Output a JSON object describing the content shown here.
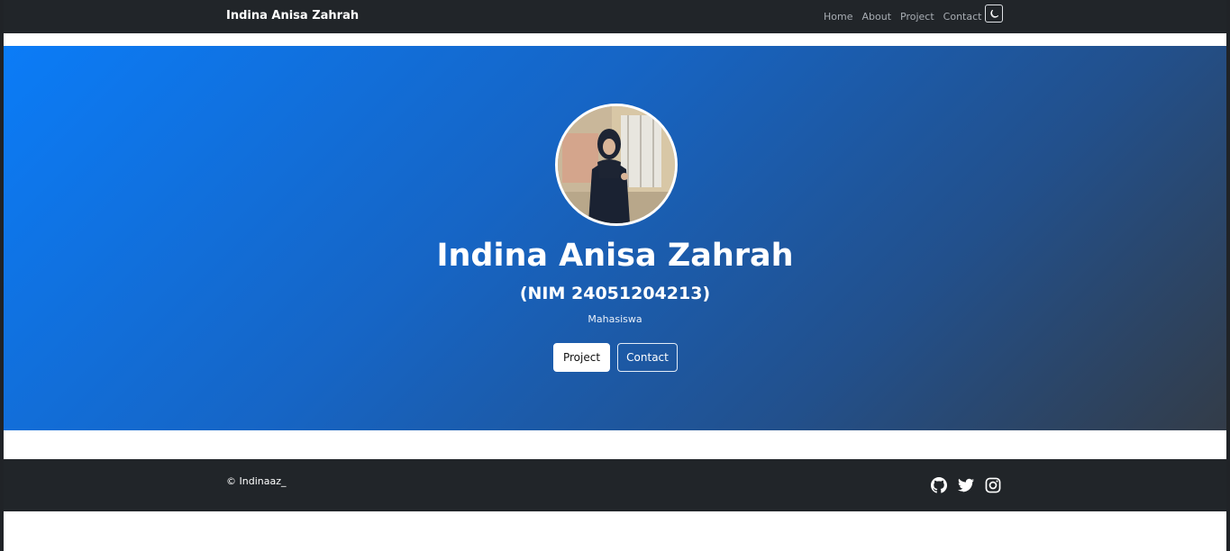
{
  "navbar": {
    "brand": "Indina Anisa Zahrah",
    "links": [
      "Home",
      "About",
      "Project",
      "Contact"
    ],
    "theme_toggle_icon": "moon-icon"
  },
  "hero": {
    "avatar_icon": "profile-photo",
    "name": "Indina Anisa Zahrah",
    "nim": "(NIM 24051204213)",
    "role": "Mahasiswa",
    "buttons": {
      "project": "Project",
      "contact": "Contact"
    },
    "gradient_colors": [
      "#0b7cf7",
      "#333c48"
    ]
  },
  "footer": {
    "copyright": "© Indinaaz_",
    "social_icons": [
      "github-icon",
      "twitter-icon",
      "instagram-icon"
    ]
  },
  "colors": {
    "navbar_bg": "#212529",
    "accent": "#0d6efd"
  }
}
